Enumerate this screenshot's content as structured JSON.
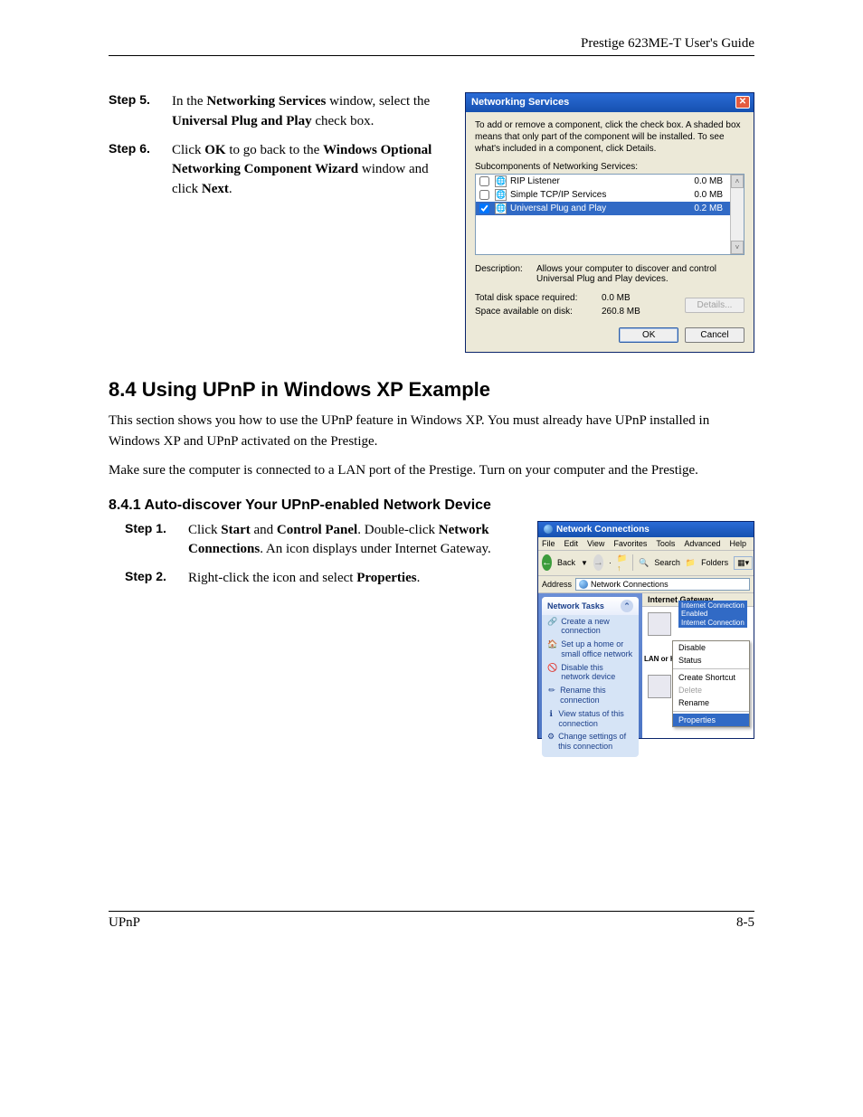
{
  "header": {
    "guide_title": "Prestige 623ME-T User's Guide"
  },
  "steps_a": [
    {
      "label": "Step 5.",
      "pre": "In the ",
      "b1": "Networking Services",
      "mid1": " window, select the ",
      "b2": "Universal Plug and Play",
      "post": " check box."
    },
    {
      "label": "Step 6.",
      "pre": "Click ",
      "b1": "OK",
      "mid1": " to go back to the ",
      "b2": "Windows Optional Networking Component Wizard",
      "mid2": " window and click ",
      "b3": "Next",
      "post": "."
    }
  ],
  "dlg": {
    "title": "Networking Services",
    "instr": "To add or remove a component, click the check box. A shaded box means that only part of the component will be installed. To see what's included in a component, click Details.",
    "sub_label": "Subcomponents of Networking Services:",
    "items": [
      {
        "name": "RIP Listener",
        "size": "0.0 MB",
        "checked": false,
        "selected": false
      },
      {
        "name": "Simple TCP/IP Services",
        "size": "0.0 MB",
        "checked": false,
        "selected": false
      },
      {
        "name": "Universal Plug and Play",
        "size": "0.2 MB",
        "checked": true,
        "selected": true
      }
    ],
    "desc_label": "Description:",
    "desc_text": "Allows your computer to discover and control Universal Plug and Play devices.",
    "space": {
      "req_label": "Total disk space required:",
      "req_val": "0.0 MB",
      "avail_label": "Space available on disk:",
      "avail_val": "260.8 MB"
    },
    "btn_details": "Details...",
    "btn_ok": "OK",
    "btn_cancel": "Cancel"
  },
  "section": {
    "h2": "8.4    Using UPnP in Windows XP Example",
    "p1": "This section shows you how to use the UPnP feature in Windows XP. You must already have UPnP installed in Windows XP and UPnP activated on the Prestige.",
    "p2": "Make sure the computer is connected to a LAN port of the Prestige. Turn on your computer and the Prestige.",
    "h3": "8.4.1  Auto-discover Your UPnP-enabled Network Device"
  },
  "steps_b": [
    {
      "label": "Step 1.",
      "pre": "Click ",
      "b1": "Start",
      "mid1": " and ",
      "b2": "Control Panel",
      "mid2": ". Double-click ",
      "b3": "Network Connections",
      "post": ". An icon displays under Internet Gateway."
    },
    {
      "label": "Step 2.",
      "pre": "Right-click the icon and select ",
      "b1": "Properties",
      "post": "."
    }
  ],
  "win": {
    "title": "Network Connections",
    "menu": [
      "File",
      "Edit",
      "View",
      "Favorites",
      "Tools",
      "Advanced",
      "Help"
    ],
    "tb_back": "Back",
    "tb_search": "Search",
    "tb_folders": "Folders",
    "addr_label": "Address",
    "addr_value": "Network Connections",
    "tasks_title": "Network Tasks",
    "tasks": [
      "Create a new connection",
      "Set up a home or small office network",
      "Disable this network device",
      "Rename this connection",
      "View status of this connection",
      "Change settings of this connection"
    ],
    "cat_hdr": "Internet Gateway",
    "conn_label_1": "Internet Connection",
    "conn_label_2": "Enabled",
    "conn_label_3": "Internet Connection",
    "lan_hdr": "LAN or H",
    "ctx": [
      "Disable",
      "Status",
      "",
      "Create Shortcut",
      "Delete",
      "Rename",
      "",
      "Properties"
    ]
  },
  "footer": {
    "left": "UPnP",
    "right": "8-5"
  }
}
